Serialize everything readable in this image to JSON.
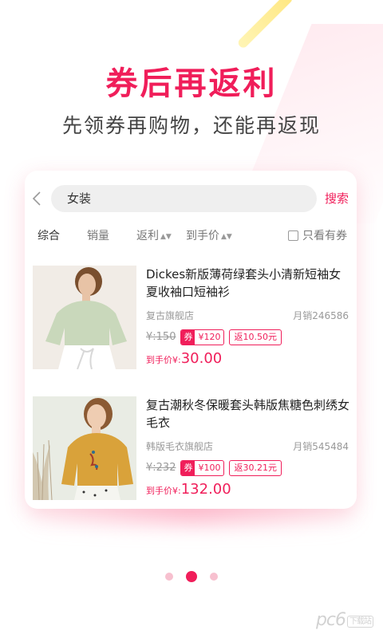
{
  "headline": "券后再返利",
  "subline": "先领券再购物，还能再返现",
  "search": {
    "query": "女装",
    "button_label": "搜索"
  },
  "filters": {
    "comprehensive": "综合",
    "sales": "销量",
    "rebate": "返利",
    "final_price": "到手价",
    "only_coupon": "只看有券"
  },
  "products": [
    {
      "title": "Dickes新版薄荷绿套头小清新短袖女夏收袖口短袖衫",
      "shop": "复古旗舰店",
      "monthly_sales": "月销246586",
      "original_price": "¥:150",
      "coupon_tag": "券",
      "coupon_value": "¥120",
      "rebate": "返10.50元",
      "final_price_label": "到手价¥:",
      "final_price": "30.00"
    },
    {
      "title": "复古潮秋冬保暖套头韩版焦糖色刺绣女毛衣",
      "shop": "韩版毛衣旗舰店",
      "monthly_sales": "月销545484",
      "original_price": "¥:232",
      "coupon_tag": "券",
      "coupon_value": "¥100",
      "rebate": "返30.21元",
      "final_price_label": "到手价¥:",
      "final_price": "132.00"
    }
  ],
  "pagination": {
    "total": 3,
    "active_index": 1
  },
  "watermark": {
    "text": "pc6",
    "sub": "下载站"
  },
  "colors": {
    "accent": "#f01e5a",
    "text": "#222222",
    "muted": "#999999"
  },
  "icons": {
    "back": "chevron-left-icon",
    "sort": "sort-arrows-icon",
    "checkbox": "checkbox-icon"
  }
}
